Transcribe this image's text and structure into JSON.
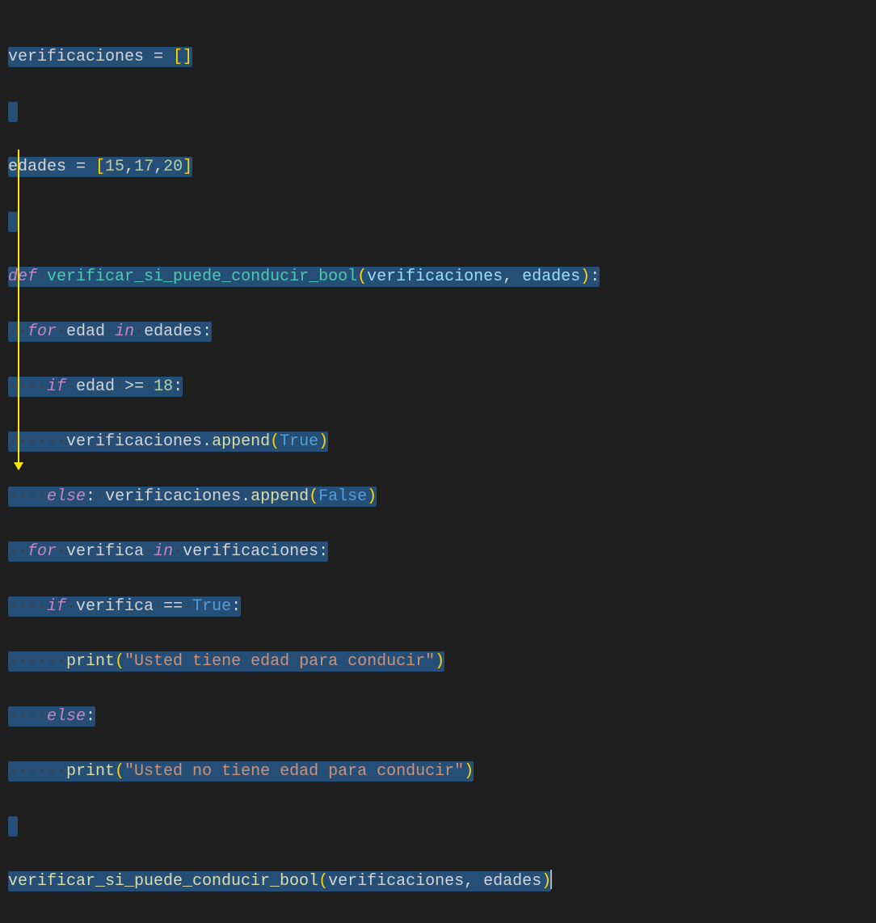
{
  "code": {
    "line1": {
      "var": "verificaciones",
      "eq": " = ",
      "brackets": "[]"
    },
    "line3": {
      "var": "edades",
      "eq": " = ",
      "open": "[",
      "n1": "15",
      "c1": ",",
      "n2": "17",
      "c2": ",",
      "n3": "20",
      "close": "]"
    },
    "line5": {
      "def": "def",
      "sp": " ",
      "fn": "verificar_si_puede_conducir_bool",
      "open": "(",
      "p1": "verificaciones",
      "comma": ", ",
      "p2": "edades",
      "close": ")",
      "colon": ":"
    },
    "line6": {
      "indent": "··",
      "for": "for",
      "sp1": " ",
      "var": "edad",
      "sp2": " ",
      "in": "in",
      "sp3": " ",
      "iter": "edades",
      "colon": ":"
    },
    "line7": {
      "indent": "····",
      "if": "if",
      "sp1": " ",
      "var": "edad",
      "sp2": " ",
      "op": ">=",
      "sp3": " ",
      "num": "18",
      "colon": ":"
    },
    "line8": {
      "indent": "······",
      "var": "verificaciones",
      "dot": ".",
      "fn": "append",
      "open": "(",
      "bool": "True",
      "close": ")"
    },
    "line9": {
      "indent": "····",
      "else": "else",
      "colon": ":",
      "sp": " ",
      "var": "verificaciones",
      "dot": ".",
      "fn": "append",
      "open": "(",
      "bool": "False",
      "close": ")"
    },
    "line10": {
      "indent": "··",
      "for": "for",
      "sp1": " ",
      "var": "verifica",
      "sp2": " ",
      "in": "in",
      "sp3": " ",
      "iter": "verificaciones",
      "colon": ":"
    },
    "line11": {
      "indent": "····",
      "if": "if",
      "sp1": " ",
      "var": "verifica",
      "sp2": " ",
      "op": "==",
      "sp3": " ",
      "bool": "True",
      "colon": ":"
    },
    "line12": {
      "indent": "······",
      "fn": "print",
      "open": "(",
      "str": "\"Usted tiene edad para conducir\"",
      "close": ")"
    },
    "line13": {
      "indent": "····",
      "else": "else",
      "colon": ":"
    },
    "line14": {
      "indent": "······",
      "fn": "print",
      "open": "(",
      "str": "\"Usted no tiene edad para conducir\"",
      "close": ")"
    },
    "line16": {
      "fn": "verificar_si_puede_conducir_bool",
      "open": "(",
      "p1": "verificaciones",
      "comma": ", ",
      "p2": "edades",
      "close": ")"
    }
  }
}
